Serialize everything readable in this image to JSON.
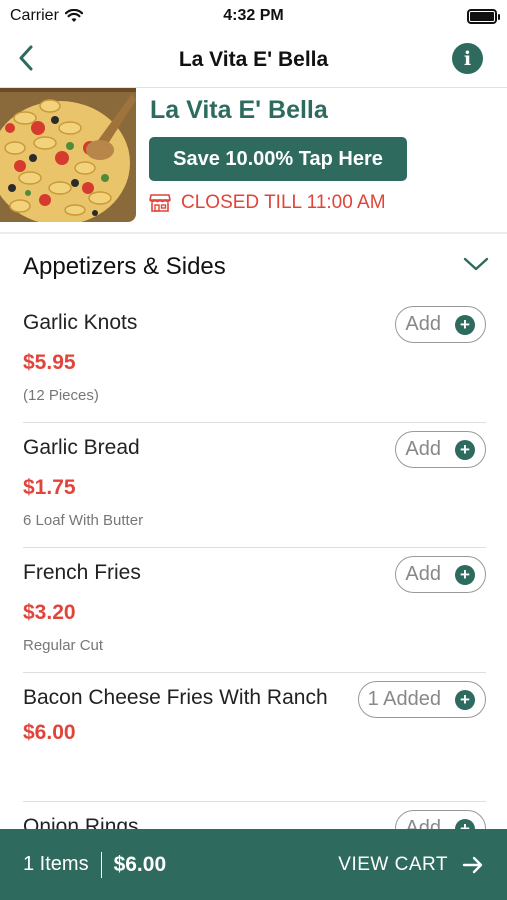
{
  "status_bar": {
    "carrier": "Carrier",
    "time": "4:32 PM"
  },
  "nav": {
    "title": "La Vita E' Bella"
  },
  "restaurant": {
    "name": "La Vita E' Bella",
    "save_label": "Save 10.00% Tap Here",
    "closed_label": "CLOSED TILL 11:00 AM"
  },
  "section": {
    "title": "Appetizers & Sides"
  },
  "items": [
    {
      "name": "Garlic Knots",
      "price": "$5.95",
      "description": "(12 Pieces)",
      "button": "Add"
    },
    {
      "name": "Garlic Bread",
      "price": "$1.75",
      "description": "6 Loaf With Butter",
      "button": "Add"
    },
    {
      "name": "French Fries",
      "price": "$3.20",
      "description": "Regular Cut",
      "button": "Add"
    },
    {
      "name": "Bacon Cheese Fries With Ranch",
      "price": "$6.00",
      "description": "",
      "button": "1 Added"
    },
    {
      "name": "Onion Rings",
      "price": "",
      "description": "",
      "button": "Add"
    }
  ],
  "cart": {
    "items_label": "1 Items",
    "total": "$6.00",
    "view_cart_label": "VIEW CART"
  },
  "colors": {
    "brand": "#2e6b5e",
    "price": "#e0443a",
    "closed": "#e0443a"
  }
}
